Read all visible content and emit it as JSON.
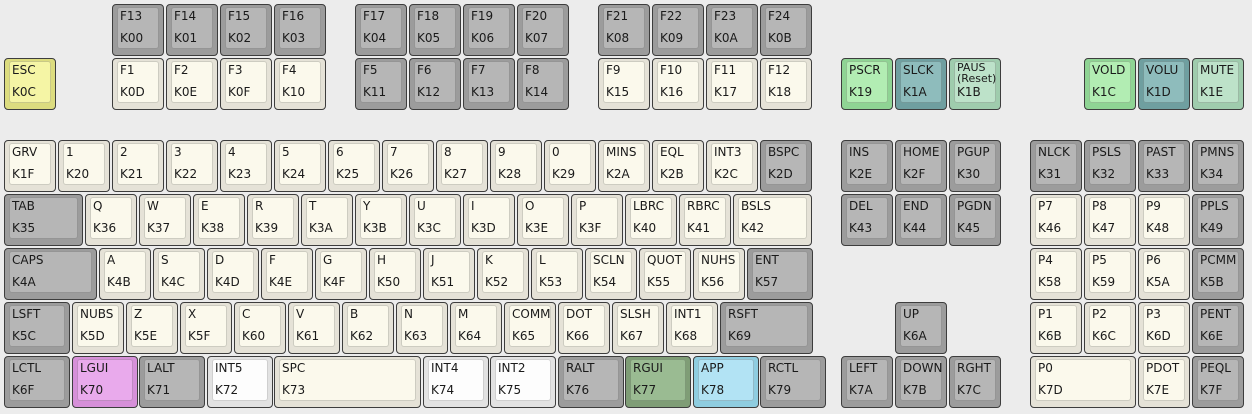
{
  "colors": {
    "alpha": [
      "#e5e2d7",
      "#fbf9ec"
    ],
    "mod": [
      "#9c9c9c",
      "#b6b6b6"
    ],
    "esc": [
      "#dcdc7f",
      "#f5f5a5"
    ],
    "green": [
      "#8fd494",
      "#b2edb3"
    ],
    "teal": [
      "#6f9fa0",
      "#8ebcbc"
    ],
    "lightgreen": [
      "#9fccad",
      "#bde2c9"
    ],
    "purple": [
      "#d690d9",
      "#e9aaec"
    ],
    "white": [
      "#e2e2e2",
      "#fdfdfd"
    ],
    "darkgreen": [
      "#7f9d76",
      "#9abb92"
    ],
    "blue": [
      "#8fcde0",
      "#b2e3f4"
    ]
  },
  "keys": [
    {
      "id": "f13",
      "l1": "F13",
      "l2": "K00",
      "c": "mod"
    },
    {
      "id": "f14",
      "l1": "F14",
      "l2": "K01",
      "c": "mod"
    },
    {
      "id": "f15",
      "l1": "F15",
      "l2": "K02",
      "c": "mod"
    },
    {
      "id": "f16",
      "l1": "F16",
      "l2": "K03",
      "c": "mod"
    },
    {
      "id": "f17",
      "l1": "F17",
      "l2": "K04",
      "c": "mod"
    },
    {
      "id": "f18",
      "l1": "F18",
      "l2": "K05",
      "c": "mod"
    },
    {
      "id": "f19",
      "l1": "F19",
      "l2": "K06",
      "c": "mod"
    },
    {
      "id": "f20",
      "l1": "F20",
      "l2": "K07",
      "c": "mod"
    },
    {
      "id": "f21",
      "l1": "F21",
      "l2": "K08",
      "c": "mod"
    },
    {
      "id": "f22",
      "l1": "F22",
      "l2": "K09",
      "c": "mod"
    },
    {
      "id": "f23",
      "l1": "F23",
      "l2": "K0A",
      "c": "mod"
    },
    {
      "id": "f24",
      "l1": "F24",
      "l2": "K0B",
      "c": "mod"
    },
    {
      "id": "esc",
      "l1": "ESC",
      "l2": "K0C",
      "c": "esc"
    },
    {
      "id": "f1",
      "l1": "F1",
      "l2": "K0D",
      "c": "alpha"
    },
    {
      "id": "f2",
      "l1": "F2",
      "l2": "K0E",
      "c": "alpha"
    },
    {
      "id": "f3",
      "l1": "F3",
      "l2": "K0F",
      "c": "alpha"
    },
    {
      "id": "f4",
      "l1": "F4",
      "l2": "K10",
      "c": "alpha"
    },
    {
      "id": "f5",
      "l1": "F5",
      "l2": "K11",
      "c": "mod"
    },
    {
      "id": "f6",
      "l1": "F6",
      "l2": "K12",
      "c": "mod"
    },
    {
      "id": "f7",
      "l1": "F7",
      "l2": "K13",
      "c": "mod"
    },
    {
      "id": "f8",
      "l1": "F8",
      "l2": "K14",
      "c": "mod"
    },
    {
      "id": "f9",
      "l1": "F9",
      "l2": "K15",
      "c": "alpha"
    },
    {
      "id": "f10",
      "l1": "F10",
      "l2": "K16",
      "c": "alpha"
    },
    {
      "id": "f11",
      "l1": "F11",
      "l2": "K17",
      "c": "alpha"
    },
    {
      "id": "f12",
      "l1": "F12",
      "l2": "K18",
      "c": "alpha"
    },
    {
      "id": "pscr",
      "l1": "PSCR",
      "l2": "K19",
      "c": "green"
    },
    {
      "id": "slck",
      "l1": "SLCK",
      "l2": "K1A",
      "c": "teal"
    },
    {
      "id": "paus",
      "l1": "PAUS\n(Reset)",
      "l2": "K1B",
      "c": "lightgreen",
      "small": true
    },
    {
      "id": "vold",
      "l1": "VOLD",
      "l2": "K1C",
      "c": "green"
    },
    {
      "id": "volu",
      "l1": "VOLU",
      "l2": "K1D",
      "c": "teal"
    },
    {
      "id": "mute",
      "l1": "MUTE",
      "l2": "K1E",
      "c": "lightgreen"
    },
    {
      "id": "grv",
      "l1": "GRV",
      "l2": "K1F",
      "c": "alpha"
    },
    {
      "id": "1",
      "l1": "1",
      "l2": "K20",
      "c": "alpha"
    },
    {
      "id": "2",
      "l1": "2",
      "l2": "K21",
      "c": "alpha"
    },
    {
      "id": "3",
      "l1": "3",
      "l2": "K22",
      "c": "alpha"
    },
    {
      "id": "4",
      "l1": "4",
      "l2": "K23",
      "c": "alpha"
    },
    {
      "id": "5",
      "l1": "5",
      "l2": "K24",
      "c": "alpha"
    },
    {
      "id": "6",
      "l1": "6",
      "l2": "K25",
      "c": "alpha"
    },
    {
      "id": "7",
      "l1": "7",
      "l2": "K26",
      "c": "alpha"
    },
    {
      "id": "8",
      "l1": "8",
      "l2": "K27",
      "c": "alpha"
    },
    {
      "id": "9",
      "l1": "9",
      "l2": "K28",
      "c": "alpha"
    },
    {
      "id": "0",
      "l1": "0",
      "l2": "K29",
      "c": "alpha"
    },
    {
      "id": "mins",
      "l1": "MINS",
      "l2": "K2A",
      "c": "alpha"
    },
    {
      "id": "eql",
      "l1": "EQL",
      "l2": "K2B",
      "c": "alpha"
    },
    {
      "id": "int3",
      "l1": "INT3",
      "l2": "K2C",
      "c": "alpha"
    },
    {
      "id": "bspc",
      "l1": "BSPC",
      "l2": "K2D",
      "c": "mod"
    },
    {
      "id": "ins",
      "l1": "INS",
      "l2": "K2E",
      "c": "mod"
    },
    {
      "id": "home",
      "l1": "HOME",
      "l2": "K2F",
      "c": "mod"
    },
    {
      "id": "pgup",
      "l1": "PGUP",
      "l2": "K30",
      "c": "mod"
    },
    {
      "id": "nlck",
      "l1": "NLCK",
      "l2": "K31",
      "c": "mod"
    },
    {
      "id": "psls",
      "l1": "PSLS",
      "l2": "K32",
      "c": "mod"
    },
    {
      "id": "past",
      "l1": "PAST",
      "l2": "K33",
      "c": "mod"
    },
    {
      "id": "pmns",
      "l1": "PMNS",
      "l2": "K34",
      "c": "mod"
    },
    {
      "id": "tab",
      "l1": "TAB",
      "l2": "K35",
      "c": "mod"
    },
    {
      "id": "q",
      "l1": "Q",
      "l2": "K36",
      "c": "alpha"
    },
    {
      "id": "w",
      "l1": "W",
      "l2": "K37",
      "c": "alpha"
    },
    {
      "id": "e",
      "l1": "E",
      "l2": "K38",
      "c": "alpha"
    },
    {
      "id": "r",
      "l1": "R",
      "l2": "K39",
      "c": "alpha"
    },
    {
      "id": "t",
      "l1": "T",
      "l2": "K3A",
      "c": "alpha"
    },
    {
      "id": "y",
      "l1": "Y",
      "l2": "K3B",
      "c": "alpha"
    },
    {
      "id": "u",
      "l1": "U",
      "l2": "K3C",
      "c": "alpha"
    },
    {
      "id": "i",
      "l1": "I",
      "l2": "K3D",
      "c": "alpha"
    },
    {
      "id": "o",
      "l1": "O",
      "l2": "K3E",
      "c": "alpha"
    },
    {
      "id": "p",
      "l1": "P",
      "l2": "K3F",
      "c": "alpha"
    },
    {
      "id": "lbrc",
      "l1": "LBRC",
      "l2": "K40",
      "c": "alpha"
    },
    {
      "id": "rbrc",
      "l1": "RBRC",
      "l2": "K41",
      "c": "alpha"
    },
    {
      "id": "bsls",
      "l1": "BSLS",
      "l2": "K42",
      "c": "alpha"
    },
    {
      "id": "del",
      "l1": "DEL",
      "l2": "K43",
      "c": "mod"
    },
    {
      "id": "end",
      "l1": "END",
      "l2": "K44",
      "c": "mod"
    },
    {
      "id": "pgdn",
      "l1": "PGDN",
      "l2": "K45",
      "c": "mod"
    },
    {
      "id": "p7",
      "l1": "P7",
      "l2": "K46",
      "c": "alpha"
    },
    {
      "id": "p8",
      "l1": "P8",
      "l2": "K47",
      "c": "alpha"
    },
    {
      "id": "p9",
      "l1": "P9",
      "l2": "K48",
      "c": "alpha"
    },
    {
      "id": "ppls",
      "l1": "PPLS",
      "l2": "K49",
      "c": "mod"
    },
    {
      "id": "caps",
      "l1": "CAPS",
      "l2": "K4A",
      "c": "mod"
    },
    {
      "id": "a",
      "l1": "A",
      "l2": "K4B",
      "c": "alpha"
    },
    {
      "id": "s",
      "l1": "S",
      "l2": "K4C",
      "c": "alpha"
    },
    {
      "id": "d",
      "l1": "D",
      "l2": "K4D",
      "c": "alpha"
    },
    {
      "id": "f",
      "l1": "F",
      "l2": "K4E",
      "c": "alpha"
    },
    {
      "id": "g",
      "l1": "G",
      "l2": "K4F",
      "c": "alpha"
    },
    {
      "id": "h",
      "l1": "H",
      "l2": "K50",
      "c": "alpha"
    },
    {
      "id": "j",
      "l1": "J",
      "l2": "K51",
      "c": "alpha"
    },
    {
      "id": "k",
      "l1": "K",
      "l2": "K52",
      "c": "alpha"
    },
    {
      "id": "l",
      "l1": "L",
      "l2": "K53",
      "c": "alpha"
    },
    {
      "id": "scln",
      "l1": "SCLN",
      "l2": "K54",
      "c": "alpha"
    },
    {
      "id": "quot",
      "l1": "QUOT",
      "l2": "K55",
      "c": "alpha"
    },
    {
      "id": "nuhs",
      "l1": "NUHS",
      "l2": "K56",
      "c": "alpha"
    },
    {
      "id": "ent",
      "l1": "ENT",
      "l2": "K57",
      "c": "mod"
    },
    {
      "id": "p4",
      "l1": "P4",
      "l2": "K58",
      "c": "alpha"
    },
    {
      "id": "p5",
      "l1": "P5",
      "l2": "K59",
      "c": "alpha"
    },
    {
      "id": "p6",
      "l1": "P6",
      "l2": "K5A",
      "c": "alpha"
    },
    {
      "id": "pcmm",
      "l1": "PCMM",
      "l2": "K5B",
      "c": "mod"
    },
    {
      "id": "lsft",
      "l1": "LSFT",
      "l2": "K5C",
      "c": "mod"
    },
    {
      "id": "nubs",
      "l1": "NUBS",
      "l2": "K5D",
      "c": "alpha"
    },
    {
      "id": "z",
      "l1": "Z",
      "l2": "K5E",
      "c": "alpha"
    },
    {
      "id": "x",
      "l1": "X",
      "l2": "K5F",
      "c": "alpha"
    },
    {
      "id": "c",
      "l1": "C",
      "l2": "K60",
      "c": "alpha"
    },
    {
      "id": "v",
      "l1": "V",
      "l2": "K61",
      "c": "alpha"
    },
    {
      "id": "b",
      "l1": "B",
      "l2": "K62",
      "c": "alpha"
    },
    {
      "id": "n",
      "l1": "N",
      "l2": "K63",
      "c": "alpha"
    },
    {
      "id": "m",
      "l1": "M",
      "l2": "K64",
      "c": "alpha"
    },
    {
      "id": "comm",
      "l1": "COMM",
      "l2": "K65",
      "c": "alpha"
    },
    {
      "id": "dot",
      "l1": "DOT",
      "l2": "K66",
      "c": "alpha"
    },
    {
      "id": "slsh",
      "l1": "SLSH",
      "l2": "K67",
      "c": "alpha"
    },
    {
      "id": "int1",
      "l1": "INT1",
      "l2": "K68",
      "c": "alpha"
    },
    {
      "id": "rsft",
      "l1": "RSFT",
      "l2": "K69",
      "c": "mod"
    },
    {
      "id": "up",
      "l1": "UP",
      "l2": "K6A",
      "c": "mod"
    },
    {
      "id": "p1",
      "l1": "P1",
      "l2": "K6B",
      "c": "alpha"
    },
    {
      "id": "p2",
      "l1": "P2",
      "l2": "K6C",
      "c": "alpha"
    },
    {
      "id": "p3",
      "l1": "P3",
      "l2": "K6D",
      "c": "alpha"
    },
    {
      "id": "pent",
      "l1": "PENT",
      "l2": "K6E",
      "c": "mod"
    },
    {
      "id": "lctl",
      "l1": "LCTL",
      "l2": "K6F",
      "c": "mod"
    },
    {
      "id": "lgui",
      "l1": "LGUI",
      "l2": "K70",
      "c": "purple"
    },
    {
      "id": "lalt",
      "l1": "LALT",
      "l2": "K71",
      "c": "mod"
    },
    {
      "id": "int5",
      "l1": "INT5",
      "l2": "K72",
      "c": "white"
    },
    {
      "id": "spc",
      "l1": "SPC",
      "l2": "K73",
      "c": "alpha"
    },
    {
      "id": "int4",
      "l1": "INT4",
      "l2": "K74",
      "c": "white"
    },
    {
      "id": "int2",
      "l1": "INT2",
      "l2": "K75",
      "c": "white"
    },
    {
      "id": "ralt",
      "l1": "RALT",
      "l2": "K76",
      "c": "mod"
    },
    {
      "id": "rgui",
      "l1": "RGUI",
      "l2": "K77",
      "c": "darkgreen"
    },
    {
      "id": "app",
      "l1": "APP",
      "l2": "K78",
      "c": "blue"
    },
    {
      "id": "rctl",
      "l1": "RCTL",
      "l2": "K79",
      "c": "mod"
    },
    {
      "id": "left",
      "l1": "LEFT",
      "l2": "K7A",
      "c": "mod"
    },
    {
      "id": "down",
      "l1": "DOWN",
      "l2": "K7B",
      "c": "mod"
    },
    {
      "id": "rght",
      "l1": "RGHT",
      "l2": "K7C",
      "c": "mod"
    },
    {
      "id": "p0",
      "l1": "P0",
      "l2": "K7D",
      "c": "alpha"
    },
    {
      "id": "pdot",
      "l1": "PDOT",
      "l2": "K7E",
      "c": "alpha"
    },
    {
      "id": "peql",
      "l1": "PEQL",
      "l2": "K7F",
      "c": "mod"
    }
  ]
}
